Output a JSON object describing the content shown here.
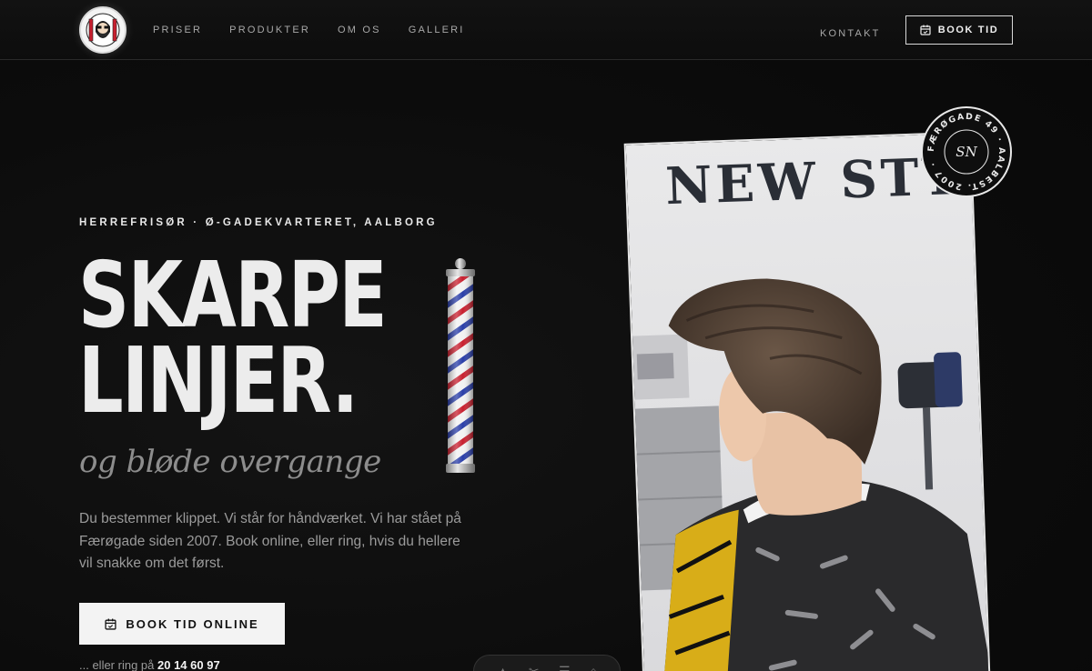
{
  "nav": {
    "items": [
      "PRISER",
      "PRODUKTER",
      "OM OS",
      "GALLERI"
    ],
    "contact": "KONTAKT",
    "book": "BOOK TID"
  },
  "hero": {
    "eyebrow": "HERREFRISØR · Ø-GADEKVARTERET, AALBORG",
    "headline_1": "SKARPE",
    "headline_2": "LINJER.",
    "subline": "og bløde overgange",
    "description": "Du bestemmer klippet. Vi står for håndværket. Vi har stået på Færøgade siden 2007. Book online, eller ring, hvis du hellere vil snakke om det først.",
    "cta": "BOOK TID ONLINE",
    "call_prefix": "... eller ring på",
    "phone": "20 14 60 97"
  },
  "photo": {
    "wall_sign": "NEW STY"
  },
  "badge": {
    "ring_text": "FÆRØGADE 49 · AALBEST. 2007 ·",
    "monogram": "SN"
  },
  "colors": {
    "background": "#0c0c0c",
    "accent_light": "#f3f3f3",
    "muted_text": "#9b9b9b",
    "pole_red": "#c8202f",
    "pole_blue": "#2a3ea8"
  },
  "icons": [
    "barber-logo-icon",
    "calendar-icon",
    "barber-pole-icon"
  ]
}
